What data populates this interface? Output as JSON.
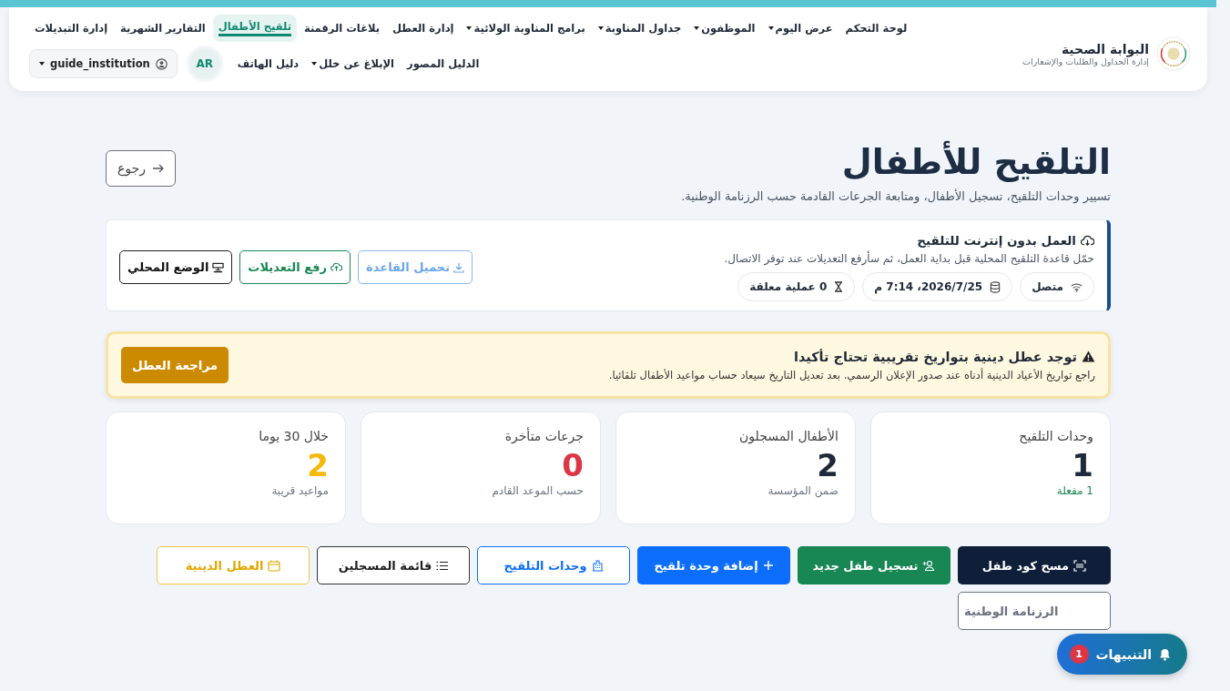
{
  "brand": {
    "title": "البوابة الصحية",
    "subtitle": "إدارة الجداول والطلبات والإشعارات"
  },
  "nav": [
    {
      "label": "لوحة التحكم",
      "dropdown": false,
      "selected": false
    },
    {
      "label": "عرض اليوم",
      "dropdown": true,
      "selected": false
    },
    {
      "label": "الموظفون",
      "dropdown": true,
      "selected": false
    },
    {
      "label": "جداول المناوبة",
      "dropdown": true,
      "selected": false
    },
    {
      "label": "برامج المناوبة الولائية",
      "dropdown": true,
      "selected": false
    },
    {
      "label": "إدارة العطل",
      "dropdown": false,
      "selected": false
    },
    {
      "label": "بلاغات الرقمنة",
      "dropdown": false,
      "selected": false
    },
    {
      "label": "تلقيح الأطفال",
      "dropdown": false,
      "selected": true
    },
    {
      "label": "التقارير الشهرية",
      "dropdown": false,
      "selected": false
    },
    {
      "label": "إدارة التبديلات",
      "dropdown": false,
      "selected": false
    },
    {
      "label": "الدليل المصور",
      "dropdown": false,
      "selected": false
    },
    {
      "label": "الإبلاغ عن خلل",
      "dropdown": true,
      "selected": false
    },
    {
      "label": "دليل الهاتف",
      "dropdown": false,
      "selected": false
    }
  ],
  "language": "AR",
  "user": "guide_institution",
  "page": {
    "title": "التلقيح للأطفال",
    "subtitle": "تسيير وحدات التلقيح، تسجيل الأطفال، ومتابعة الجرعات القادمة حسب الرزنامة الوطنية.",
    "back": "رجوع"
  },
  "offline": {
    "title": "العمل بدون إنترنت للتلقيح",
    "text": "حمّل قاعدة التلقيح المحلية قبل بداية العمل، ثم سأرفع التعديلات عند توفر الاتصال.",
    "chips": [
      {
        "kind": "wifi",
        "label": "متصل"
      },
      {
        "kind": "database",
        "label": "2026/7/25، 7:14 م"
      },
      {
        "kind": "hourglass",
        "label": "0 عملية معلقة"
      }
    ],
    "buttons": [
      {
        "kind": "download",
        "label": "تحميل القاعدة"
      },
      {
        "kind": "upload",
        "label": "رفع التعديلات"
      },
      {
        "kind": "local",
        "label": "الوضع المحلي"
      }
    ]
  },
  "alert": {
    "title": "توجد عطل دينية بتواريخ تقريبية تحتاج تأكيدا",
    "text": "راجع تواريخ الأعياد الدينية أدناه عند صدور الإعلان الرسمي. بعد تعديل التاريخ سيعاد حساب مواعيد الأطفال تلقائيا.",
    "button": "مراجعة العطل"
  },
  "stats": [
    {
      "kind": "success",
      "label": "وحدات التلقيح",
      "value": "1",
      "note": "1 مفعلة"
    },
    {
      "kind": "neutral",
      "label": "الأطفال المسجلون",
      "value": "2",
      "note": "ضمن المؤسسة"
    },
    {
      "kind": "danger",
      "label": "جرعات متأخرة",
      "value": "0",
      "note": "حسب الموعد القادم"
    },
    {
      "kind": "warning",
      "label": "خلال 30 يوما",
      "value": "2",
      "note": "مواعيد قريبة"
    }
  ],
  "actions": [
    {
      "kind": "scan",
      "label": "مسح كود طفل"
    },
    {
      "kind": "register",
      "label": "تسجيل طفل جديد"
    },
    {
      "kind": "add",
      "label": "إضافة وحدة تلقيح"
    },
    {
      "kind": "units",
      "label": "وحدات التلقيح"
    },
    {
      "kind": "list",
      "label": "قائمة المسجلين"
    },
    {
      "kind": "holidays",
      "label": "العطل الدينية"
    },
    {
      "kind": "calendar",
      "label": "الرزنامة الوطنية"
    }
  ],
  "notifications": {
    "label": "التنبيهات",
    "count": "1"
  }
}
